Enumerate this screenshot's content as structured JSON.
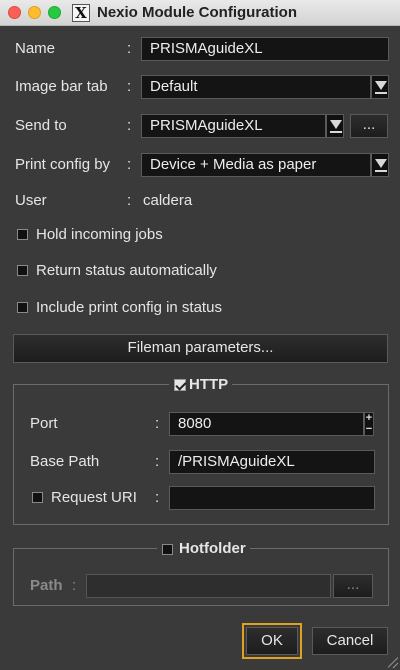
{
  "window": {
    "title": "Nexio Module Configuration",
    "app_icon_glyph": "X"
  },
  "form": {
    "name": {
      "label": "Name",
      "value": "PRISMAguideXL"
    },
    "image_bar_tab": {
      "label": "Image bar tab",
      "value": "Default"
    },
    "send_to": {
      "label": "Send to",
      "value": "PRISMAguideXL",
      "browse_label": "..."
    },
    "print_config_by": {
      "label": "Print config by",
      "value": "Device + Media as paper"
    },
    "user": {
      "label": "User",
      "value": "caldera"
    },
    "colon": ":"
  },
  "options": {
    "hold_incoming_jobs": {
      "label": "Hold incoming jobs",
      "checked": false
    },
    "return_status": {
      "label": "Return status automatically",
      "checked": false
    },
    "include_print_config": {
      "label": "Include print config in status",
      "checked": false
    }
  },
  "fileman_button": "Fileman parameters...",
  "http": {
    "title": "HTTP",
    "enabled": true,
    "port": {
      "label": "Port",
      "value": "8080",
      "spin_up": "+",
      "spin_down": "−"
    },
    "base_path": {
      "label": "Base Path",
      "value": "/PRISMAguideXL"
    },
    "request_uri": {
      "label": "Request URI",
      "value": "",
      "checked": false
    }
  },
  "hotfolder": {
    "title": "Hotfolder",
    "enabled": false,
    "path": {
      "label": "Path",
      "value": "",
      "browse_label": "..."
    }
  },
  "buttons": {
    "ok": "OK",
    "cancel": "Cancel"
  }
}
